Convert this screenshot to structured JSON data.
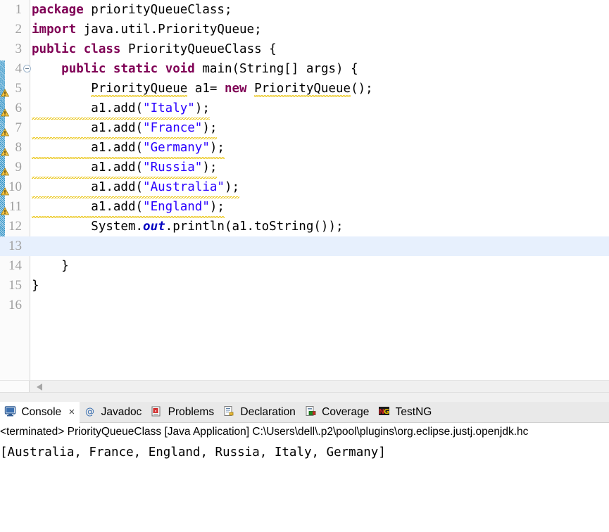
{
  "editor": {
    "current_line": 13,
    "change_bar_from_line": 4,
    "fold_marker_line": 4,
    "warning_lines": [
      5,
      6,
      7,
      8,
      9,
      10,
      11
    ],
    "line_numbers": [
      "1",
      "2",
      "3",
      "4",
      "5",
      "6",
      "7",
      "8",
      "9",
      "10",
      "11",
      "12",
      "13",
      "14",
      "15",
      "16"
    ],
    "lines": [
      {
        "n": "1",
        "text": "package priorityQueueClass;"
      },
      {
        "n": "2",
        "text": "import java.util.PriorityQueue;"
      },
      {
        "n": "3",
        "text": "public class PriorityQueueClass {"
      },
      {
        "n": "4",
        "text": "    public static void main(String[] args) {"
      },
      {
        "n": "5",
        "text": "        PriorityQueue a1= new PriorityQueue();"
      },
      {
        "n": "6",
        "text": "        a1.add(\"Italy\");"
      },
      {
        "n": "7",
        "text": "        a1.add(\"France\");"
      },
      {
        "n": "8",
        "text": "        a1.add(\"Germany\");"
      },
      {
        "n": "9",
        "text": "        a1.add(\"Russia\");"
      },
      {
        "n": "10",
        "text": "        a1.add(\"Australia\");"
      },
      {
        "n": "11",
        "text": "        a1.add(\"England\");"
      },
      {
        "n": "12",
        "text": "        System.out.println(a1.toString());"
      },
      {
        "n": "13",
        "text": ""
      },
      {
        "n": "14",
        "text": "    }"
      },
      {
        "n": "15",
        "text": "}"
      },
      {
        "n": "16",
        "text": ""
      }
    ],
    "tokens": {
      "l1_kw": "package",
      "l1_rest": " priorityQueueClass;",
      "l2_kw": "import",
      "l2_rest": " java.util.PriorityQueue;",
      "l3_kw1": "public",
      "l3_sp1": " ",
      "l3_kw2": "class",
      "l3_rest": " PriorityQueueClass {",
      "l4_indent": "    ",
      "l4_kw1": "public",
      "l4_sp1": " ",
      "l4_kw2": "static",
      "l4_sp2": " ",
      "l4_kw3": "void",
      "l4_rest": " main(String[] args) {",
      "l5_indent": "        ",
      "l5_type1": "PriorityQueue",
      "l5_mid": " a1= ",
      "l5_kw": "new",
      "l5_sp": " ",
      "l5_type2": "PriorityQueue",
      "l5_end": "();",
      "l6_pre": "        a1.add(",
      "l6_str": "\"Italy\"",
      "l6_post": ");",
      "l7_pre": "        a1.add(",
      "l7_str": "\"France\"",
      "l7_post": ");",
      "l8_pre": "        a1.add(",
      "l8_str": "\"Germany\"",
      "l8_post": ");",
      "l9_pre": "        a1.add(",
      "l9_str": "\"Russia\"",
      "l9_post": ");",
      "l10_pre": "        a1.add(",
      "l10_str": "\"Australia\"",
      "l10_post": ");",
      "l11_pre": "        a1.add(",
      "l11_str": "\"England\"",
      "l11_post": ");",
      "l12_pre": "        System.",
      "l12_field": "out",
      "l12_post": ".println(a1.toString());",
      "l14_text": "    }",
      "l15_text": "}"
    },
    "scrollbar": {
      "left_arrow_icon": "triangle-left-icon"
    }
  },
  "console": {
    "tabs": [
      {
        "label": "Console",
        "icon": "console-monitor-icon",
        "active": true,
        "closable": true,
        "close_label": "×"
      },
      {
        "label": "Javadoc",
        "icon": "javadoc-at-icon",
        "active": false,
        "closable": false,
        "close_label": ""
      },
      {
        "label": "Problems",
        "icon": "problems-error-icon",
        "active": false,
        "closable": false,
        "close_label": ""
      },
      {
        "label": "Declaration",
        "icon": "declaration-doc-icon",
        "active": false,
        "closable": false,
        "close_label": ""
      },
      {
        "label": "Coverage",
        "icon": "coverage-report-icon",
        "active": false,
        "closable": false,
        "close_label": ""
      },
      {
        "label": "TestNG",
        "icon": "testng-logo-icon",
        "active": false,
        "closable": false,
        "close_label": ""
      }
    ],
    "terminated_line": "<terminated> PriorityQueueClass [Java Application] C:\\Users\\dell\\.p2\\pool\\plugins\\org.eclipse.justj.openjdk.hc",
    "output": "[Australia, France, England, Russia, Italy, Germany]"
  },
  "colors": {
    "keyword": "#7F0055",
    "string": "#2A00FF",
    "field": "#0000C0",
    "current_line": "#E7F0FD",
    "warning_squiggle": "#E8C000",
    "change_bar": "#51A5D0",
    "gutter_bg": "#FBFBFB",
    "tabbar_bg": "#E9E9E9"
  }
}
